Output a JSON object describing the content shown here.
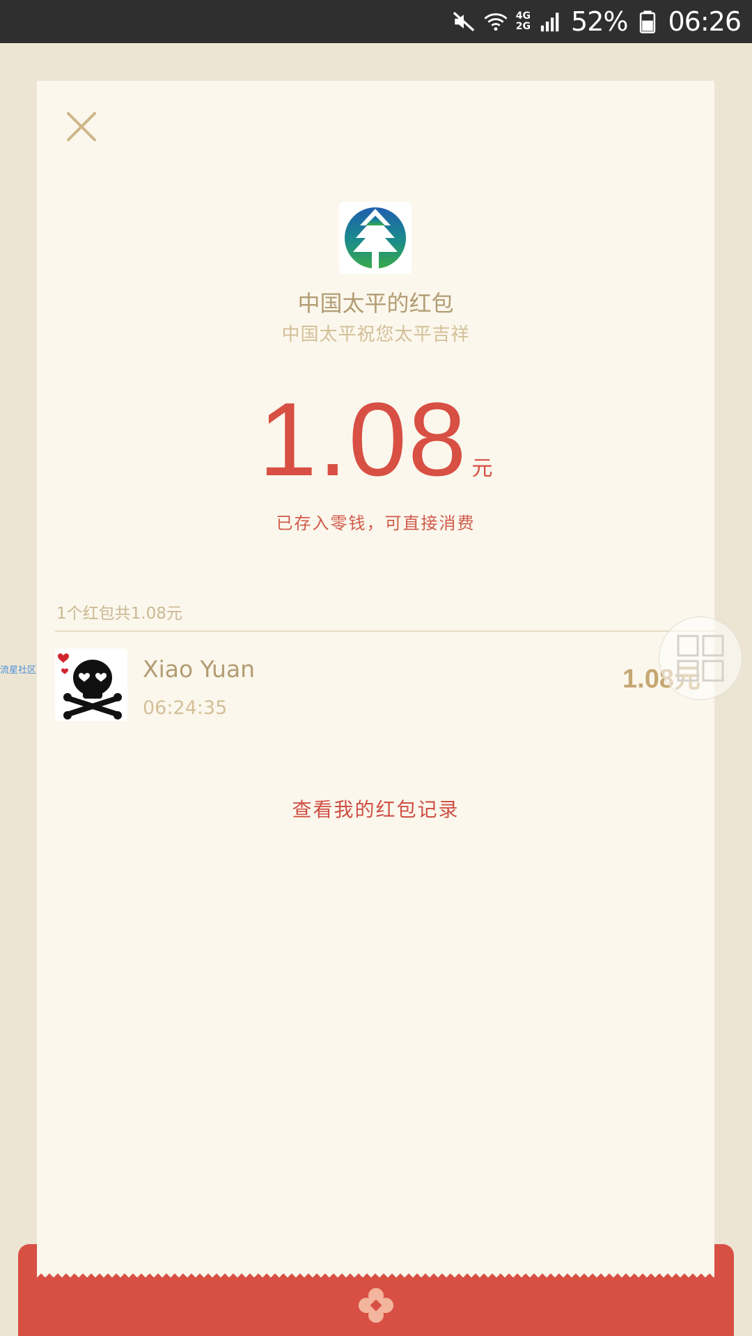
{
  "status_bar": {
    "network_top": "4G",
    "network_bottom": "2G",
    "battery": "52%",
    "time": "06:26"
  },
  "packet": {
    "sender_title": "中国太平的红包",
    "greeting": "中国太平祝您太平吉祥",
    "amount": "1.08",
    "unit": "元",
    "stored_note": "已存入零钱，可直接消费",
    "summary": "1个红包共1.08元",
    "history_link": "查看我的红包记录"
  },
  "record": {
    "name": "Xiao Yuan",
    "time": "06:24:35",
    "amount": "1.08元"
  },
  "side_label": "流星社区",
  "colors": {
    "accent_red": "#d84f44",
    "gold_text": "#b29c73",
    "card_bg": "#fbf7ec",
    "page_bg": "#ede5d3"
  },
  "icons": [
    "mute-icon",
    "wifi-icon",
    "signal-icon",
    "battery-icon",
    "close-icon",
    "insurer-logo",
    "skull-avatar",
    "grid-icon",
    "flower-emblem-icon"
  ]
}
